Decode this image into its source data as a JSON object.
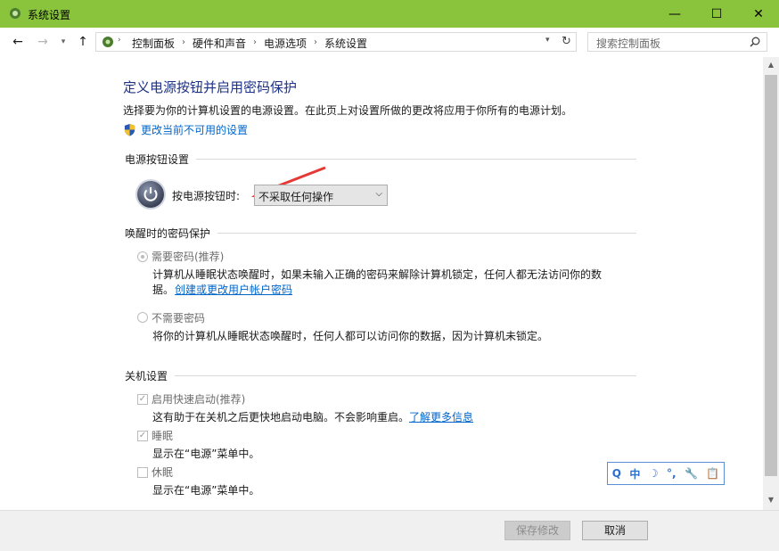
{
  "window": {
    "title": "系统设置",
    "controls": {
      "minimize": "—",
      "maximize": "☐",
      "close": "✕"
    }
  },
  "address": {
    "breadcrumbs": [
      "控制面板",
      "硬件和声音",
      "电源选项",
      "系统设置"
    ],
    "search_placeholder": "搜索控制面板"
  },
  "main": {
    "heading": "定义电源按钮并启用密码保护",
    "description": "选择要为你的计算机设置的电源设置。在此页上对设置所做的更改将应用于你所有的电源计划。",
    "change_link": "更改当前不可用的设置",
    "power_section": {
      "title": "电源按钮设置",
      "label": "按电源按钮时:",
      "select_value": "不采取任何操作"
    },
    "wake_section": {
      "title": "唤醒时的密码保护",
      "require": {
        "label": "需要密码(推荐)",
        "desc_line1": "计算机从睡眠状态唤醒时，如果未输入正确的密码来解除计算机锁定，任何人都无法访问你的数",
        "desc_line2_prefix": "据。",
        "link": "创建或更改用户帐户密码",
        "selected": true
      },
      "no_require": {
        "label": "不需要密码",
        "desc": "将你的计算机从睡眠状态唤醒时，任何人都可以访问你的数据，因为计算机未锁定。",
        "selected": false
      }
    },
    "shutdown_section": {
      "title": "关机设置",
      "items": [
        {
          "label": "启用快速启动(推荐)",
          "desc": "这有助于在关机之后更快地启动电脑。不会影响重启。",
          "link": "了解更多信息",
          "checked": true
        },
        {
          "label": "睡眠",
          "desc": "显示在“电源”菜单中。",
          "checked": true
        },
        {
          "label": "休眠",
          "desc": "显示在“电源”菜单中。",
          "checked": false
        }
      ]
    }
  },
  "footer": {
    "save_label": "保存修改",
    "cancel_label": "取消"
  },
  "ime": [
    "Q",
    "中",
    "☽",
    "°,",
    "🔧",
    "📋"
  ],
  "colors": {
    "titlebar": "#8ac43d",
    "heading": "#1e3287",
    "link": "#0066cc",
    "annotation_arrow": "#e53935"
  }
}
